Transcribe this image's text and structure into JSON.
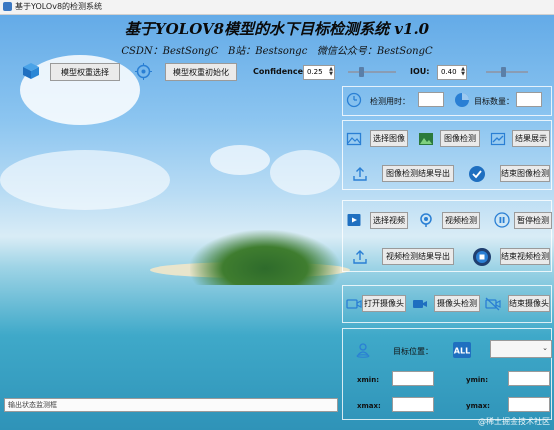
{
  "window": {
    "title": "基于YOLOv8的检测系统"
  },
  "header": {
    "title": "基于YOLOV8模型的水下目标检测系统 v1.0",
    "subtitle": "CSDN：BestSongC   B站：Bestsongc   微信公众号：BestSongC"
  },
  "model": {
    "select_weight_label": "模型权重选择",
    "init_weight_label": "模型权重初始化",
    "confidence_label": "Confidence:",
    "confidence_value": "0.25",
    "iou_label": "IOU:",
    "iou_value": "0.40",
    "confidence_slider_fraction": 0.25,
    "iou_slider_fraction": 0.4
  },
  "stats": {
    "time_label": "检测用时：",
    "time_value": "",
    "count_label": "目标数量：",
    "count_value": ""
  },
  "image": {
    "select_label": "选择图像",
    "detect_label": "图像检测",
    "show_label": "结果展示",
    "export_label": "图像检测结果导出",
    "end_label": "结束图像检测"
  },
  "video": {
    "select_label": "选择视频",
    "detect_label": "视频检测",
    "pause_label": "暂停检测",
    "export_label": "视频检测结果导出",
    "end_label": "结束视频检测"
  },
  "camera": {
    "open_label": "打开摄像头",
    "detect_label": "摄像头检测",
    "end_label": "结束摄像头"
  },
  "target": {
    "position_label": "目标位置：",
    "combo_value": "",
    "xmin_label": "xmin:",
    "ymin_label": "ymin:",
    "xmax_label": "xmax:",
    "ymax_label": "ymax:",
    "xmin_value": "",
    "ymin_value": "",
    "xmax_value": "",
    "ymax_value": ""
  },
  "status": {
    "text": "输出状态监测框"
  },
  "watermark": "@稀土掘金技术社区",
  "colors": {
    "icon_blue": "#2a7fd4",
    "icon_dark": "#1f5fa8"
  }
}
